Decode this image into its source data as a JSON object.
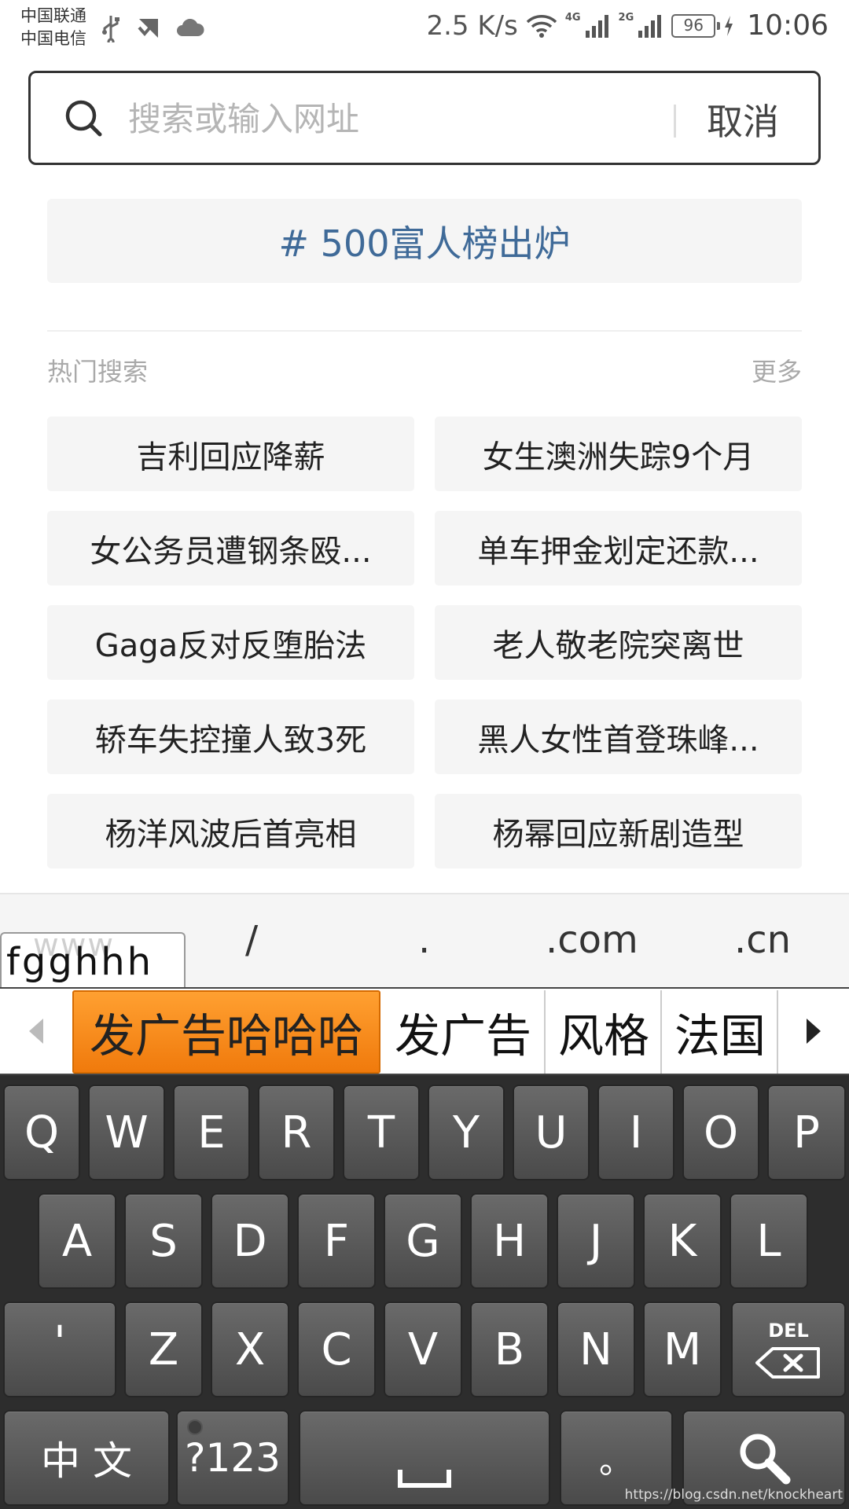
{
  "status_bar": {
    "carrier_1": "中国联通",
    "carrier_2": "中国电信",
    "net_speed": "2.5 K/s",
    "net_4g": "4G",
    "net_2g": "2G",
    "battery": "96",
    "time": "10:06"
  },
  "search": {
    "placeholder": "搜索或输入网址",
    "cancel_label": "取消"
  },
  "banner": {
    "text": "# 500富人榜出炉"
  },
  "hot_search": {
    "title": "热门搜索",
    "more_label": "更多",
    "items": [
      {
        "label": "吉利回应降薪"
      },
      {
        "label": "女生澳洲失踪9个月"
      },
      {
        "label": "女公务员遭钢条殴..."
      },
      {
        "label": "单车押金划定还款..."
      },
      {
        "label": "Gaga反对反堕胎法"
      },
      {
        "label": "老人敬老院突离世"
      },
      {
        "label": "轿车失控撞人致3死"
      },
      {
        "label": "黑人女性首登珠峰..."
      },
      {
        "label": "杨洋风波后首亮相"
      },
      {
        "label": "杨幂回应新剧造型"
      }
    ]
  },
  "url_shortcuts": {
    "slash": "/",
    "dot": ".",
    "com": ".com",
    "cn": ".cn"
  },
  "composing": {
    "ghost": "www",
    "text": "fgghhh"
  },
  "candidates": [
    {
      "label": "发广告哈哈哈"
    },
    {
      "label": "发广告"
    },
    {
      "label": "风格"
    },
    {
      "label": "法国"
    }
  ],
  "keyboard": {
    "row1": [
      "Q",
      "W",
      "E",
      "R",
      "T",
      "Y",
      "U",
      "I",
      "O",
      "P"
    ],
    "row2": [
      "A",
      "S",
      "D",
      "F",
      "G",
      "H",
      "J",
      "K",
      "L"
    ],
    "row3": [
      "'",
      "Z",
      "X",
      "C",
      "V",
      "B",
      "N",
      "M"
    ],
    "del_label": "DEL",
    "lang_label": "中 文",
    "symbols_label": "?123",
    "period_label": "。"
  },
  "watermark": "https://blog.csdn.net/knockheart",
  "colors": {
    "banner_text": "#3f6a98",
    "candidate_selected": "#f5841a",
    "keyboard_bg": "#2d2d2d"
  }
}
